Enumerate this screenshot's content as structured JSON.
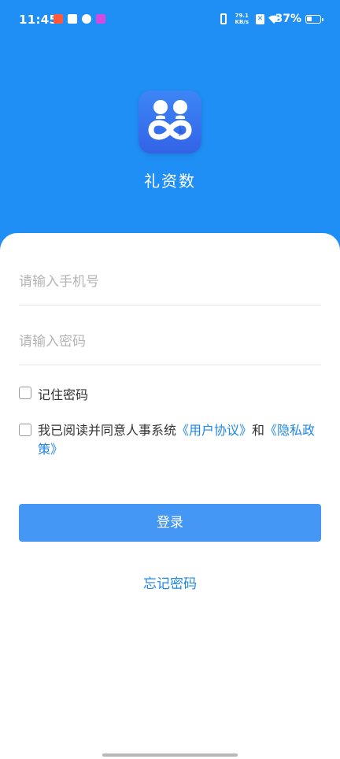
{
  "status_bar": {
    "time": "11:45",
    "net_speed_value": "79.1",
    "net_speed_unit": "KB/s",
    "sim_badge": "✕",
    "battery_percent": "37%",
    "battery_level": 0.37
  },
  "app": {
    "name": "礼资数",
    "logo_icon": "infinity-people-logo-icon"
  },
  "login_form": {
    "phone_placeholder": "请输入手机号",
    "phone_value": "",
    "password_placeholder": "请输入密码",
    "password_value": "",
    "remember_label": "记住密码",
    "remember_checked": false,
    "agreement_prefix": "我已阅读并同意人事系统",
    "user_agreement_link": "《用户协议》",
    "agreement_and": "和",
    "privacy_policy_link": "《隐私政策》",
    "agreement_checked": false,
    "login_button": "登录",
    "forgot_password": "忘记密码"
  },
  "colors": {
    "header_blue": "#1f8ff6",
    "button_blue": "#4497f5",
    "link_blue": "#1f86e8"
  }
}
